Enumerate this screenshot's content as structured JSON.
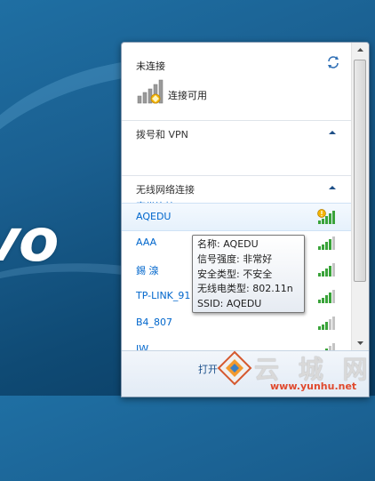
{
  "desktop": {
    "logo_text": "vo"
  },
  "flyout": {
    "status": {
      "title": "未连接",
      "available_text": "连接可用"
    },
    "dialup_group": {
      "label": "拨号和 VPN",
      "items": [
        {
          "label": "宽带连接"
        }
      ]
    },
    "wireless_group": {
      "label": "无线网络连接",
      "networks": [
        {
          "name": "AQEDU",
          "secured": false,
          "signal_bars": 5,
          "selected": true
        },
        {
          "name": "AAA",
          "signal_bars": 4
        },
        {
          "name": "錫  湶",
          "signal_bars": 4
        },
        {
          "name": "TP-LINK_91",
          "signal_bars": 4
        },
        {
          "name": "B4_807",
          "signal_bars": 3
        },
        {
          "name": "JW",
          "signal_bars": 3
        }
      ]
    },
    "footer": {
      "open_label": "打开"
    }
  },
  "tooltip": {
    "lines": [
      "名称: AQEDU",
      "信号强度: 非常好",
      "安全类型: 不安全",
      "无线电类型: 802.11n",
      "SSID: AQEDU"
    ]
  },
  "watermark": {
    "text": "云 城 网",
    "url": "www.yunhu.net"
  },
  "colors": {
    "link": "#0066cc",
    "signal_green": "#3aa33a",
    "warning": "#e8a200"
  }
}
